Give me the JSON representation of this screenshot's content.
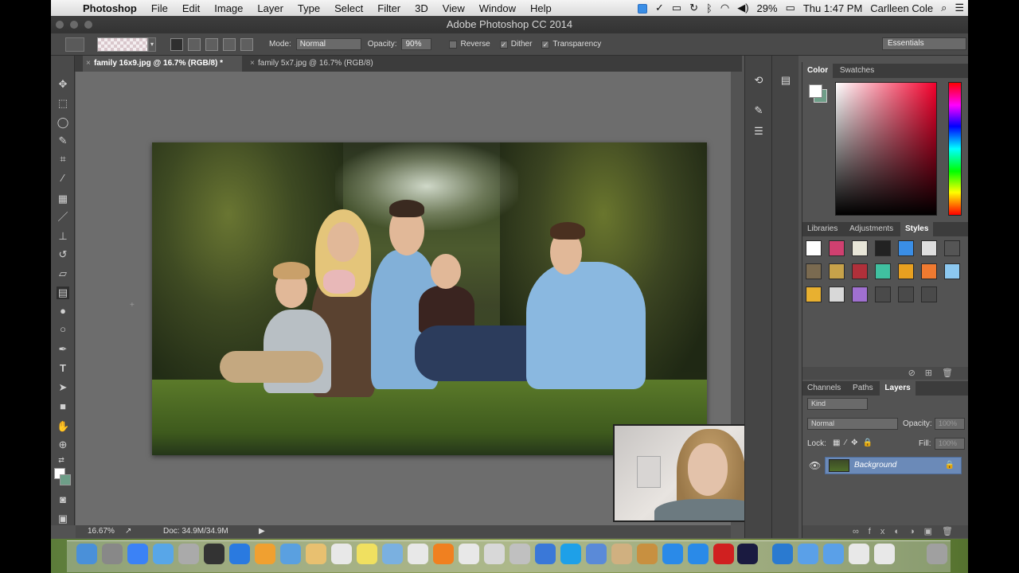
{
  "menubar": {
    "app": "Photoshop",
    "items": [
      "File",
      "Edit",
      "Image",
      "Layer",
      "Type",
      "Select",
      "Filter",
      "3D",
      "View",
      "Window",
      "Help"
    ],
    "battery": "29%",
    "clock": "Thu 1:47 PM",
    "user": "Carlleen Cole"
  },
  "window": {
    "title": "Adobe Photoshop CC 2014"
  },
  "options": {
    "mode_label": "Mode:",
    "mode_value": "Normal",
    "opacity_label": "Opacity:",
    "opacity_value": "90%",
    "reverse": "Reverse",
    "dither": "Dither",
    "transparency": "Transparency",
    "workspace": "Essentials"
  },
  "tabs": [
    {
      "label": "family 16x9.jpg @ 16.7% (RGB/8) *",
      "active": true
    },
    {
      "label": "family 5x7.jpg @ 16.7% (RGB/8)",
      "active": false
    }
  ],
  "status": {
    "zoom": "16.67%",
    "doc": "Doc: 34.9M/34.9M"
  },
  "color_panel": {
    "tabs": [
      "Color",
      "Swatches"
    ],
    "foreground": "#ffffff",
    "background": "#6e9e88"
  },
  "styles_panel": {
    "tabs": [
      "Libraries",
      "Adjustments",
      "Styles"
    ]
  },
  "layers_panel": {
    "tabs": [
      "Channels",
      "Paths",
      "Layers"
    ],
    "filter": "Kind",
    "blend_mode": "Normal",
    "opacity_label": "Opacity:",
    "opacity_value": "100%",
    "lock_label": "Lock:",
    "fill_label": "Fill:",
    "fill_value": "100%",
    "layers": [
      {
        "name": "Background",
        "visible": true,
        "locked": true
      }
    ]
  }
}
